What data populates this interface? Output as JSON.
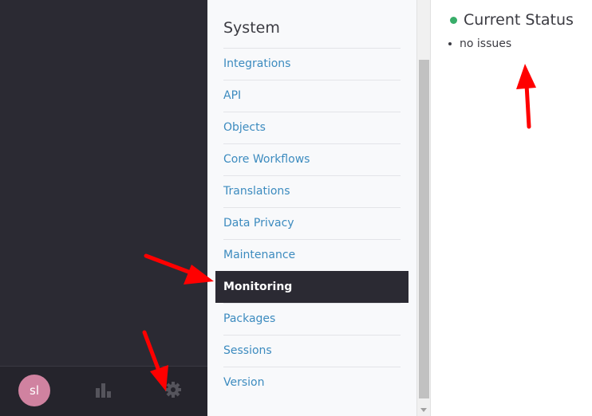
{
  "sidebar": {
    "avatar_initials": "sl",
    "icons": [
      "dashboard-icon",
      "gear-icon"
    ]
  },
  "menu": {
    "title": "System",
    "items": [
      {
        "label": "Integrations"
      },
      {
        "label": "API"
      },
      {
        "label": "Objects"
      },
      {
        "label": "Core Workflows"
      },
      {
        "label": "Translations"
      },
      {
        "label": "Data Privacy"
      },
      {
        "label": "Maintenance"
      },
      {
        "label": "Monitoring",
        "active": true
      },
      {
        "label": "Packages"
      },
      {
        "label": "Sessions"
      },
      {
        "label": "Version"
      }
    ]
  },
  "content": {
    "title": "Current Status",
    "issues": [
      "no issues"
    ]
  },
  "colors": {
    "nav_background": "#2b2a33",
    "link": "#3c8bbf",
    "status_ok": "#38ad69",
    "annotation_arrow": "#ff0000"
  }
}
